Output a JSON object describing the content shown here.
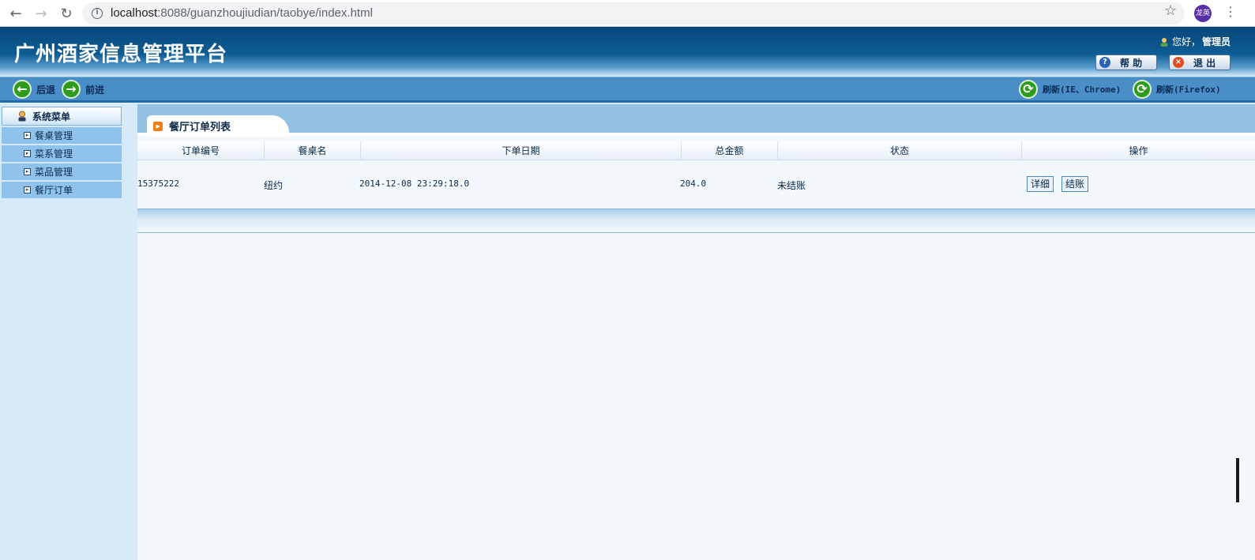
{
  "browser": {
    "url_host": "localhost",
    "url_rest": ":8088/guanzhoujiudian/taobye/index.html",
    "profile": "龙英"
  },
  "header": {
    "title": "广州酒家信息管理平台",
    "greeting": "您好，",
    "user": "管理员",
    "help_label": "帮 助",
    "exit_label": "退 出"
  },
  "toolbar": {
    "back": "后退",
    "forward": "前进",
    "refresh_ie": "刷新(IE、Chrome)",
    "refresh_ff": "刷新(Firefox)"
  },
  "sidebar": {
    "title": "系统菜单",
    "items": [
      {
        "label": "餐桌管理"
      },
      {
        "label": "菜系管理"
      },
      {
        "label": "菜品管理"
      },
      {
        "label": "餐厅订单"
      }
    ]
  },
  "main": {
    "tab_title": "餐厅订单列表",
    "columns": [
      "订单编号",
      "餐桌名",
      "下单日期",
      "总金额",
      "状态",
      "操作"
    ],
    "rows": [
      {
        "order_id": "15375222",
        "table": "纽约",
        "date": "2014-12-08 23:29:18.0",
        "amount": "204.0",
        "status": "未结账",
        "actions": [
          "详细",
          "结账"
        ]
      }
    ]
  },
  "colors": {
    "header_dark": "#08477a",
    "toolbar": "#4a8ec8",
    "sidebar_item": "#8fc3eb",
    "tab_strip": "#93c1e4"
  }
}
